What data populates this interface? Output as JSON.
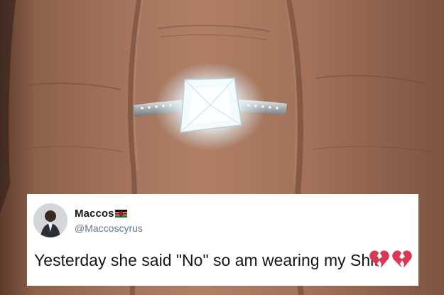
{
  "tweet": {
    "display_name": "Maccos",
    "handle": "@Maccoscyrus",
    "text": "Yesterday she said \"No\" so am wearing my Shit",
    "emoji": [
      "broken-heart-icon",
      "broken-heart-icon"
    ],
    "flag": "kenya-flag-icon"
  },
  "colors": {
    "card_bg": "#ffffff",
    "name_text": "#14171a",
    "handle_text": "#657786",
    "broken_heart": "#d83a55"
  }
}
